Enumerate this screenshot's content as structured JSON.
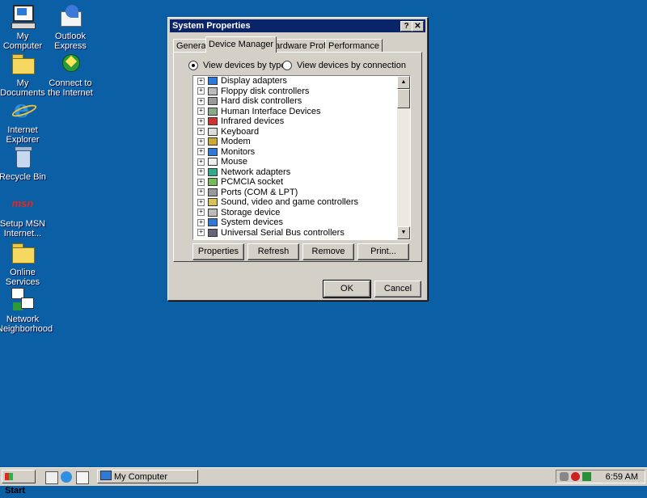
{
  "desktop": {
    "icons": [
      {
        "label": "My Computer",
        "icon": "my-computer-icon"
      },
      {
        "label": "Outlook\nExpress",
        "icon": "outlook-express-icon"
      },
      {
        "label": "My Documents",
        "icon": "my-documents-icon"
      },
      {
        "label": "Connect to\nthe Internet",
        "icon": "connect-internet-icon"
      },
      {
        "label": "Internet\nExplorer",
        "icon": "internet-explorer-icon"
      },
      {
        "label": "Recycle Bin",
        "icon": "recycle-bin-icon"
      },
      {
        "label": "Setup MSN\nInternet...",
        "icon": "msn-icon"
      },
      {
        "label": "Online\nServices",
        "icon": "folder-icon"
      },
      {
        "label": "Network\nNeighborhood",
        "icon": "network-icon"
      }
    ],
    "background": "#0b5fa5"
  },
  "dialog": {
    "title": "System Properties",
    "help_glyph": "?",
    "close_glyph": "✕",
    "tabs": [
      "General",
      "Device Manager",
      "Hardware Profiles",
      "Performance"
    ],
    "active_tab": "Device Manager",
    "radio_by_type": "View devices by type",
    "radio_by_connection": "View devices by connection",
    "devices": [
      "Display adapters",
      "Floppy disk controllers",
      "Hard disk controllers",
      "Human Interface Devices",
      "Infrared devices",
      "Keyboard",
      "Modem",
      "Monitors",
      "Mouse",
      "Network adapters",
      "PCMCIA socket",
      "Ports (COM & LPT)",
      "Sound, video and game controllers",
      "Storage device",
      "System devices",
      "Universal Serial Bus controllers"
    ],
    "expander_glyph": "+",
    "buttons": {
      "properties": "Properties",
      "refresh": "Refresh",
      "remove": "Remove",
      "print": "Print...",
      "ok": "OK",
      "cancel": "Cancel"
    },
    "title_color": "#0a246a"
  },
  "taskbar": {
    "start_label": "Start",
    "task_label": "My Computer",
    "clock": "6:59 AM"
  }
}
